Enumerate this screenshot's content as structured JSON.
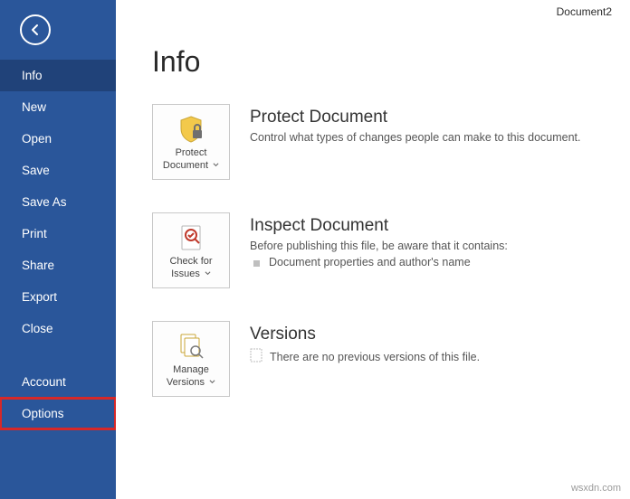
{
  "document_title": "Document2",
  "page_title": "Info",
  "sidebar": {
    "items": [
      {
        "label": "Info",
        "active": true,
        "highlighted": false
      },
      {
        "label": "New"
      },
      {
        "label": "Open"
      },
      {
        "label": "Save"
      },
      {
        "label": "Save As"
      },
      {
        "label": "Print"
      },
      {
        "label": "Share"
      },
      {
        "label": "Export"
      },
      {
        "label": "Close"
      }
    ],
    "footer_items": [
      {
        "label": "Account"
      },
      {
        "label": "Options",
        "highlighted": true
      }
    ]
  },
  "sections": {
    "protect": {
      "button_line1": "Protect",
      "button_line2": "Document",
      "title": "Protect Document",
      "desc": "Control what types of changes people can make to this document."
    },
    "inspect": {
      "button_line1": "Check for",
      "button_line2": "Issues",
      "title": "Inspect Document",
      "desc": "Before publishing this file, be aware that it contains:",
      "items": [
        "Document properties and author's name"
      ]
    },
    "versions": {
      "button_line1": "Manage",
      "button_line2": "Versions",
      "title": "Versions",
      "empty_text": "There are no previous versions of this file."
    }
  },
  "watermark": "wsxdn.com",
  "colors": {
    "sidebar_bg": "#2a569a",
    "sidebar_active": "#204279",
    "highlight_border": "#d62828"
  }
}
